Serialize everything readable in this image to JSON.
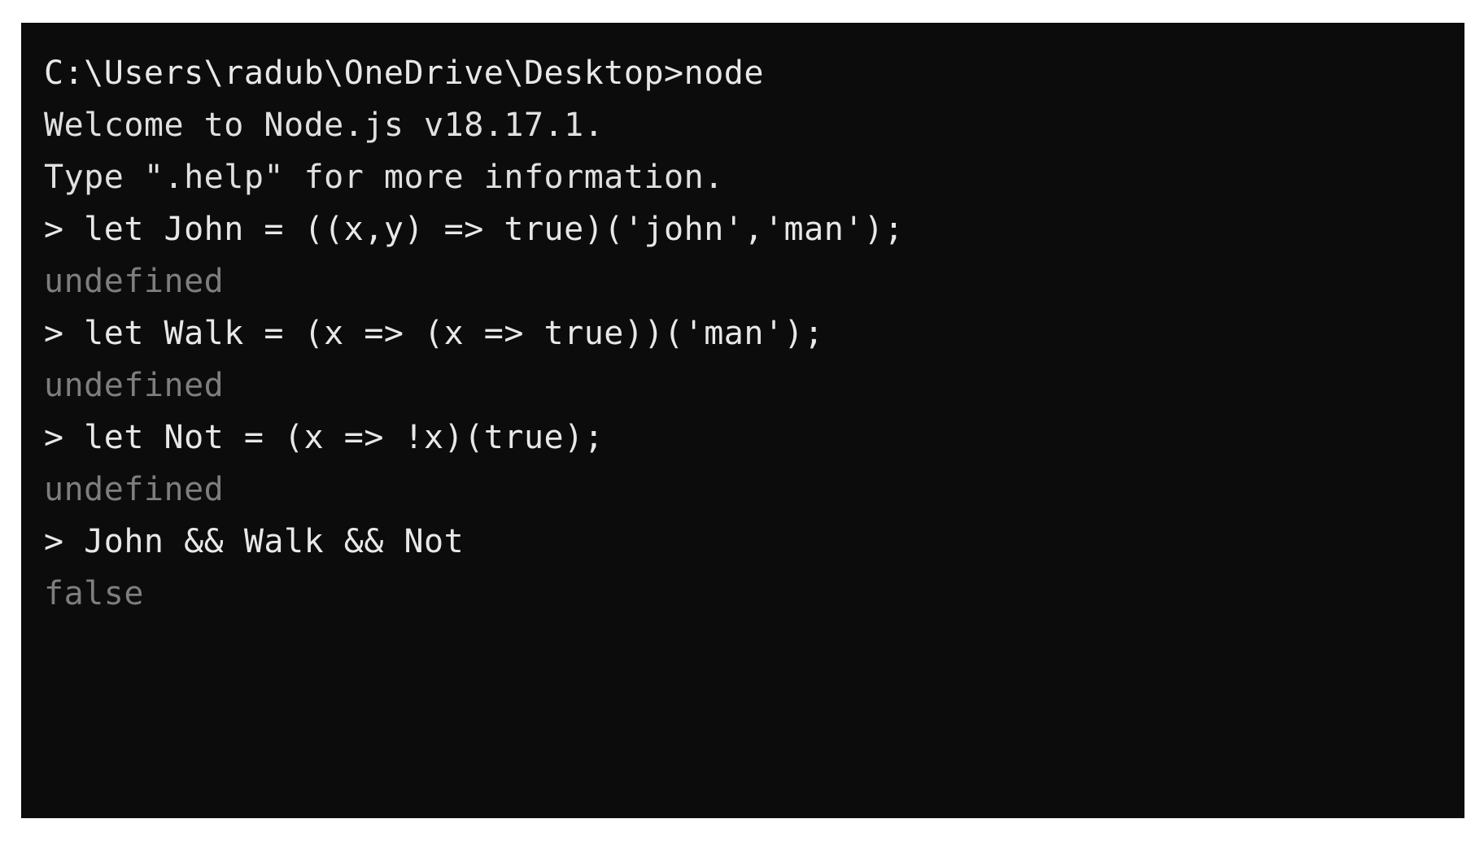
{
  "window": {
    "kind": "windows-command-prompt",
    "background_color": "#0c0c0c",
    "page_background_color": "#ffffff",
    "input_text_color": "#e8e8e8",
    "result_text_color": "#7e7e7e"
  },
  "terminal": {
    "prompt_path": "C:\\Users\\radub\\OneDrive\\Desktop>",
    "repl_prompt": ">",
    "lines": [
      {
        "id": "line-1",
        "type": "input",
        "text": "C:\\Users\\radub\\OneDrive\\Desktop>node"
      },
      {
        "id": "line-2",
        "type": "system",
        "text": "Welcome to Node.js v18.17.1."
      },
      {
        "id": "line-3",
        "type": "system",
        "text": "Type \".help\" for more information."
      },
      {
        "id": "line-4",
        "type": "input",
        "text": "> let John = ((x,y) => true)('john','man');"
      },
      {
        "id": "line-5",
        "type": "result",
        "text": "undefined"
      },
      {
        "id": "line-6",
        "type": "input",
        "text": "> let Walk = (x => (x => true))('man');"
      },
      {
        "id": "line-7",
        "type": "result",
        "text": "undefined"
      },
      {
        "id": "line-8",
        "type": "input",
        "text": "> let Not = (x => !x)(true);"
      },
      {
        "id": "line-9",
        "type": "result",
        "text": "undefined"
      },
      {
        "id": "line-10",
        "type": "input",
        "text": "> John && Walk && Not"
      },
      {
        "id": "line-11",
        "type": "result",
        "text": "false"
      }
    ],
    "node_version": "v18.17.1",
    "commands": [
      "node",
      "let John = ((x,y) => true)('john','man');",
      "let Walk = (x => (x => true))('man');",
      "let Not = (x => !x)(true);",
      "John && Walk && Not"
    ],
    "results": [
      "undefined",
      "undefined",
      "undefined",
      "false"
    ]
  }
}
